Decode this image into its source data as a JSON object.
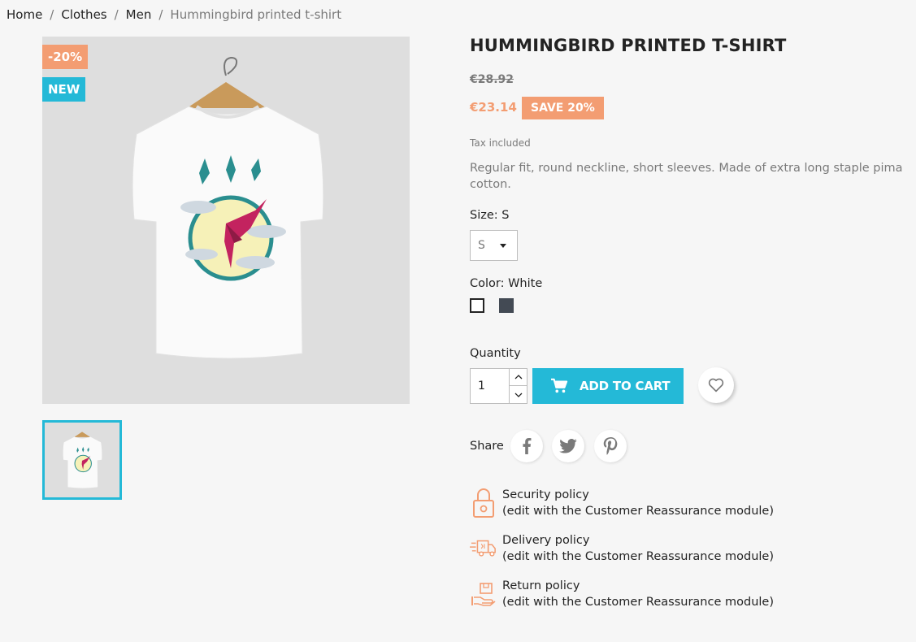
{
  "breadcrumb": {
    "items": [
      "Home",
      "Clothes",
      "Men"
    ],
    "current": "Hummingbird printed t-shirt",
    "separator": "/"
  },
  "badges": {
    "discount": "-20%",
    "new": "NEW"
  },
  "product": {
    "title": "HUMMINGBIRD PRINTED T-SHIRT",
    "old_price": "€28.92",
    "price": "€23.14",
    "save_label": "SAVE 20%",
    "tax_note": "Tax included",
    "description": "Regular fit, round neckline, short sleeves. Made of extra long staple pima cotton."
  },
  "variants": {
    "size_label": "Size: S",
    "size_selected": "S",
    "color_label": "Color: White",
    "colors": [
      {
        "name": "White",
        "hex": "#ffffff",
        "selected": true
      },
      {
        "name": "Grey",
        "hex": "#434a54",
        "selected": false
      }
    ]
  },
  "cart": {
    "quantity_label": "Quantity",
    "quantity_value": "1",
    "add_to_cart_label": "ADD TO CART"
  },
  "share": {
    "label": "Share",
    "networks": [
      "facebook-icon",
      "twitter-icon",
      "pinterest-icon"
    ]
  },
  "reassurance": [
    {
      "title": "Security policy",
      "subtitle": "(edit with the Customer Reassurance module)",
      "icon": "lock-icon"
    },
    {
      "title": "Delivery policy",
      "subtitle": "(edit with the Customer Reassurance module)",
      "icon": "truck-icon"
    },
    {
      "title": "Return policy",
      "subtitle": "(edit with the Customer Reassurance module)",
      "icon": "return-box-icon"
    }
  ],
  "colors": {
    "accent": "#24b9d7",
    "sale": "#f39d72",
    "text": "#232323",
    "muted": "#7a7a7a",
    "background": "#f6f6f6"
  }
}
